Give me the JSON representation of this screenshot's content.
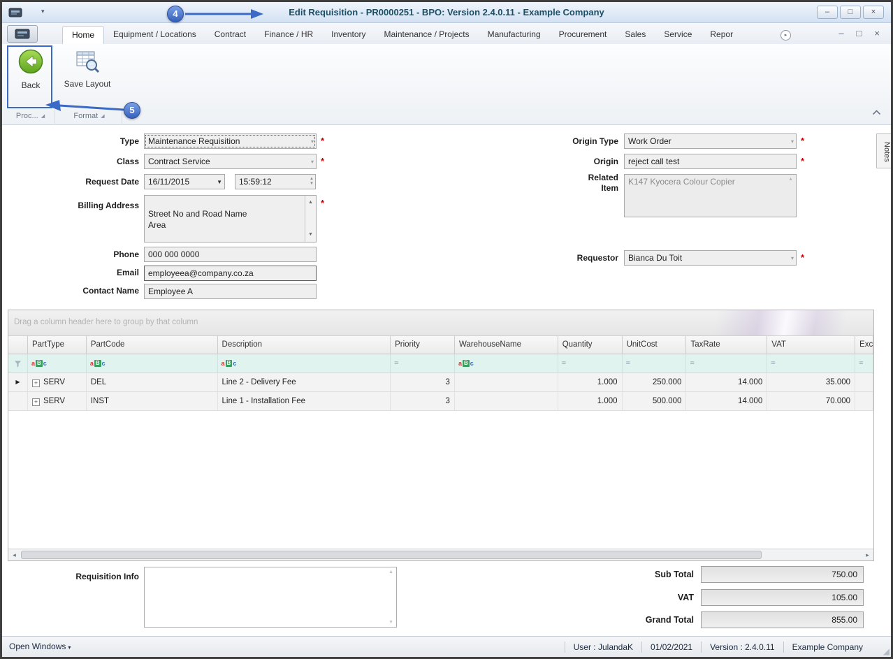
{
  "window": {
    "title": "Edit Requisition - PR0000251 - BPO: Version 2.4.0.11 - Example Company"
  },
  "icons": {
    "minimize": "–",
    "restore": "□",
    "close": "×",
    "dropdown": "▾",
    "dropdown_dark": "▼",
    "spin_up": "▲",
    "spin_down": "▼",
    "scroll_up": "▲",
    "scroll_down": "▼",
    "scroll_left": "◂",
    "scroll_right": "▸",
    "row_arrow": "▶",
    "plus": "+",
    "launcher": "◢",
    "caret_down": "▾",
    "equals": "=",
    "grip": "◢"
  },
  "ribbon": {
    "tabs": [
      "Home",
      "Equipment / Locations",
      "Contract",
      "Finance / HR",
      "Inventory",
      "Maintenance / Projects",
      "Manufacturing",
      "Procurement",
      "Sales",
      "Service",
      "Repor"
    ],
    "back_label": "Back",
    "save_layout_label": "Save Layout",
    "group1": "Proc...",
    "group2": "Format"
  },
  "annotations": {
    "step4": "4",
    "step5": "5"
  },
  "form": {
    "type_label": "Type",
    "type_value": "Maintenance Requisition",
    "class_label": "Class",
    "class_value": "Contract Service",
    "request_date_label": "Request Date",
    "request_date_value": "16/11/2015",
    "request_time_value": "15:59:12",
    "billing_address_label": "Billing Address",
    "billing_address_value": "Street No and Road Name\nArea\n\nCity",
    "phone_label": "Phone",
    "phone_value": "000 000 0000",
    "email_label": "Email",
    "email_value": "employeea@company.co.za",
    "contact_name_label": "Contact Name",
    "contact_name_value": "Employee A",
    "origin_type_label": "Origin Type",
    "origin_type_value": "Work Order",
    "origin_label": "Origin",
    "origin_value": "reject call test",
    "related_item_label": "Related Item",
    "related_item_value": "K147 Kyocera Colour Copier",
    "requestor_label": "Requestor",
    "requestor_value": "Bianca Du Toit",
    "required_marker": "*"
  },
  "grid": {
    "group_hint": "Drag a column header here to group by that column",
    "columns": [
      "PartType",
      "PartCode",
      "Description",
      "Priority",
      "WarehouseName",
      "Quantity",
      "UnitCost",
      "TaxRate",
      "VAT",
      "Exc"
    ],
    "filter_text_icon": [
      "a",
      "B",
      "c"
    ],
    "rows": [
      {
        "part_type": "SERV",
        "part_code": "DEL",
        "description": "Line 2 - Delivery Fee",
        "priority": "3",
        "warehouse": "",
        "quantity": "1.000",
        "unit_cost": "250.000",
        "tax_rate": "14.000",
        "vat": "35.000"
      },
      {
        "part_type": "SERV",
        "part_code": "INST",
        "description": "Line 1 - Installation Fee",
        "priority": "3",
        "warehouse": "",
        "quantity": "1.000",
        "unit_cost": "500.000",
        "tax_rate": "14.000",
        "vat": "70.000"
      }
    ]
  },
  "footer": {
    "requisition_info_label": "Requisition Info",
    "sub_total_label": "Sub Total",
    "sub_total_value": "750.00",
    "vat_label": "VAT",
    "vat_value": "105.00",
    "grand_total_label": "Grand Total",
    "grand_total_value": "855.00"
  },
  "statusbar": {
    "open_windows_label": "Open Windows",
    "user": "User : JulandaK",
    "date": "01/02/2021",
    "version": "Version : 2.4.0.11",
    "company": "Example Company"
  },
  "side": {
    "notes_label": "Notes"
  }
}
